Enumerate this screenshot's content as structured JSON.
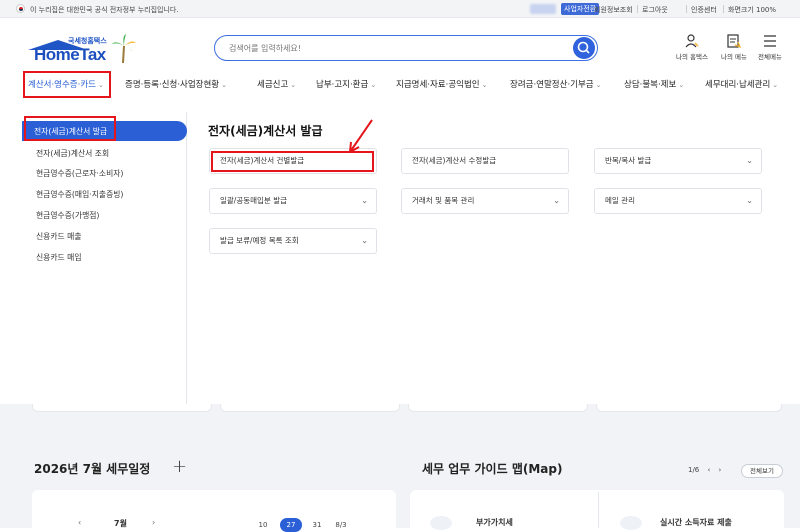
{
  "topbar": {
    "gov_notice": "이 누리집은 대한민국 공식 전자정부 누리집입니다.",
    "business_switch": "사업자전환",
    "links": [
      "회원정보조회",
      "로그아웃",
      "인증센터",
      "화면크기 100%"
    ]
  },
  "header": {
    "logo_sub": "국세청홈택스",
    "logo_main": "HomeTax",
    "search_placeholder": "검색어를 입력하세요!",
    "icons": [
      {
        "label": "나의 홈택스",
        "icon": "my-hometax-icon"
      },
      {
        "label": "나의 메뉴",
        "icon": "my-menu-icon"
      },
      {
        "label": "전체메뉴",
        "icon": "hamburger-icon"
      }
    ]
  },
  "gnb": {
    "items": [
      "계산서·영수증·카드",
      "증명·등록·신청·사업장현황",
      "세금신고",
      "납부·고지·환급",
      "지급명세·자료·공익법인",
      "장려금·연말정산·기부금",
      "상담·불복·제보",
      "세무대리·납세관리"
    ]
  },
  "lnb": {
    "items": [
      "전자(세금)계산서 발급",
      "전자(세금)계산서 조회",
      "현금영수증(근로자·소비자)",
      "현금영수증(매입·지출증빙)",
      "현금영수증(가맹점)",
      "신용카드 매출",
      "신용카드 매입"
    ]
  },
  "content": {
    "title": "전자(세금)계산서 발급",
    "cards": [
      {
        "label": "전자(세금)계산서 건별발급",
        "has_chevron": false
      },
      {
        "label": "전자(세금)계산서 수정발급",
        "has_chevron": false
      },
      {
        "label": "반복/복사 발급",
        "has_chevron": true
      },
      {
        "label": "일괄/공동매입분 발급",
        "has_chevron": true
      },
      {
        "label": "거래처 및 품목 관리",
        "has_chevron": true
      },
      {
        "label": "메일 관리",
        "has_chevron": true
      },
      {
        "label": "발급 보류/예정 목록 조회",
        "has_chevron": true
      }
    ]
  },
  "bottom": {
    "schedule_title": "2026년 7월 세무일정",
    "plus": "+",
    "map_title": "세무 업무 가이드 맵(Map)",
    "pager": "1/6",
    "all_view": "전체보기",
    "month": "7월",
    "days": [
      "10",
      "27",
      "31",
      "8/3"
    ],
    "guide_items": [
      "부가가치세",
      "실시간 소득자료 제출"
    ]
  },
  "colors": {
    "accent": "#2a5fd6",
    "highlight": "#e4161c"
  }
}
